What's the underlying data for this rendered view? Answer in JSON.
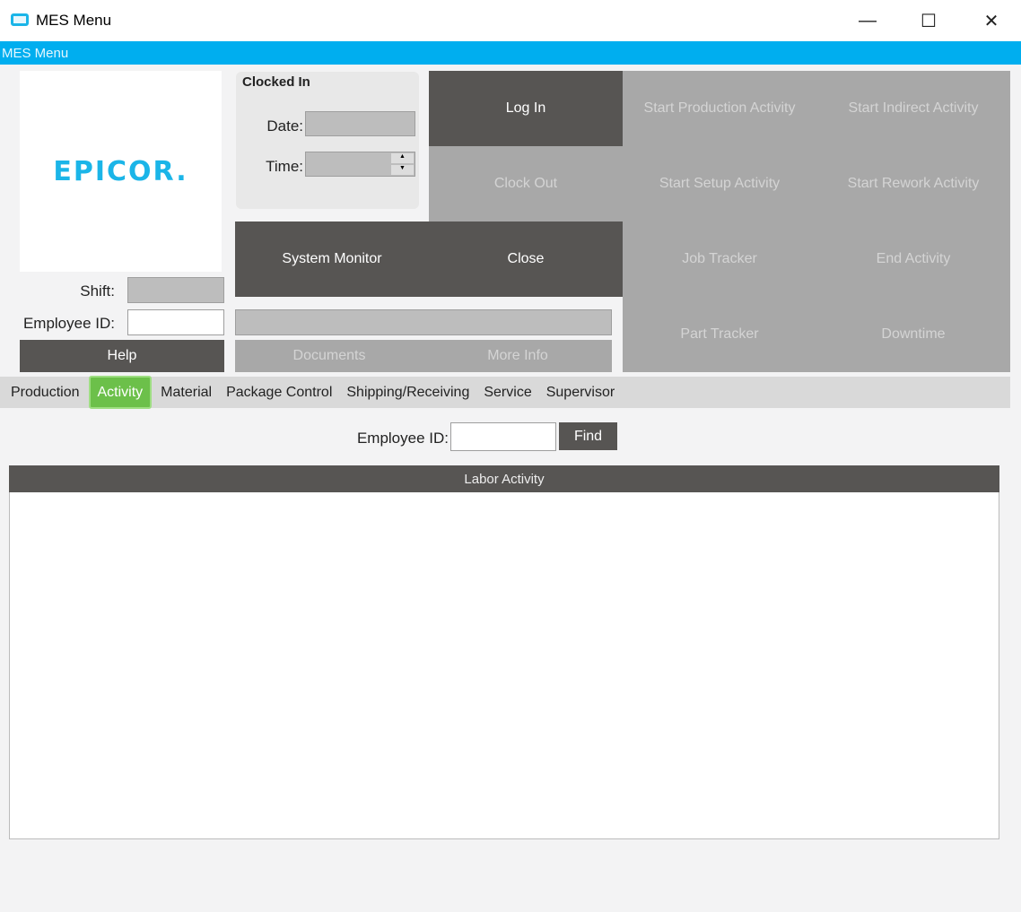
{
  "window": {
    "title": "MES Menu",
    "minimize": "—",
    "maximize": "☐",
    "close": "✕"
  },
  "header": {
    "title": "MES Menu"
  },
  "logo": {
    "text": "EPICOR."
  },
  "clock": {
    "heading": "Clocked In",
    "date_label": "Date:",
    "time_label": "Time:",
    "date": "",
    "time": ""
  },
  "shift_label": "Shift:",
  "employee_label": "Employee ID:",
  "buttons": {
    "help": "Help",
    "login": "Log In",
    "clock_out": "Clock Out",
    "system_monitor": "System Monitor",
    "close": "Close",
    "documents": "Documents",
    "more_info": "More Info",
    "start_production": "Start Production Activity",
    "start_indirect": "Start Indirect Activity",
    "start_setup": "Start Setup Activity",
    "start_rework": "Start Rework Activity",
    "job_tracker": "Job Tracker",
    "end_activity": "End Activity",
    "part_tracker": "Part Tracker",
    "downtime": "Downtime"
  },
  "tabs": [
    "Production",
    "Activity",
    "Material",
    "Package Control",
    "Shipping/Receiving",
    "Service",
    "Supervisor"
  ],
  "active_tab": "Activity",
  "activity": {
    "employee_label": "Employee ID:",
    "find": "Find",
    "grid_title": "Labor Activity"
  },
  "colors": {
    "accent": "#00aeef",
    "active_tab": "#6cc04a",
    "dark_button": "#575553"
  }
}
